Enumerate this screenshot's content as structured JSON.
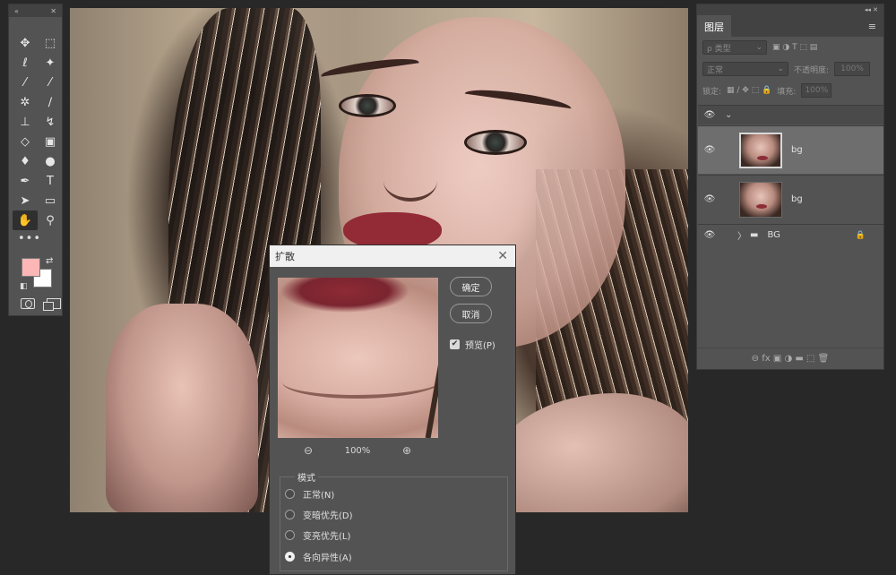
{
  "toolbar": {
    "collapse_glyph": "«",
    "close_glyph": "✕",
    "more_glyph": "•••",
    "foreground_color": "#fcb6b6",
    "background_color": "#ffffff",
    "tools": [
      {
        "name": "move-icon",
        "glyph": "✥"
      },
      {
        "name": "marquee-icon",
        "glyph": "⬚"
      },
      {
        "name": "lasso-icon",
        "glyph": "ℓ"
      },
      {
        "name": "magic-wand-icon",
        "glyph": "✦"
      },
      {
        "name": "eyedropper-icon",
        "glyph": "⁄"
      },
      {
        "name": "eyedropper-2-icon",
        "glyph": "⁄"
      },
      {
        "name": "patch-icon",
        "glyph": "✲"
      },
      {
        "name": "brush-icon",
        "glyph": "∕"
      },
      {
        "name": "stamp-icon",
        "glyph": "⊥"
      },
      {
        "name": "history-brush-icon",
        "glyph": "↯"
      },
      {
        "name": "eraser-icon",
        "glyph": "◇"
      },
      {
        "name": "gradient-icon",
        "glyph": "▣"
      },
      {
        "name": "blur-icon",
        "glyph": "♦"
      },
      {
        "name": "dodge-icon",
        "glyph": "●"
      },
      {
        "name": "pen-icon",
        "glyph": "✒"
      },
      {
        "name": "type-icon",
        "glyph": "T"
      },
      {
        "name": "path-select-icon",
        "glyph": "➤"
      },
      {
        "name": "rectangle-icon",
        "glyph": "▭"
      },
      {
        "name": "hand-icon",
        "glyph": "✋"
      },
      {
        "name": "zoom-icon",
        "glyph": "⚲"
      }
    ]
  },
  "layers_panel": {
    "top_controls": "◂◂  ✕",
    "tab_label": "图层",
    "menu_glyph": "≡",
    "filter_label": "ρ 类型",
    "filter_icons": "▣ ◑ T ⬚ ▤",
    "blend_mode": "正常",
    "opacity_label": "不透明度:",
    "opacity_value": "100%",
    "lock_label": "锁定:",
    "lock_icons": "▦ ∕ ✥ ⬚ 🔒",
    "fill_label": "填充:",
    "fill_value": "100%",
    "group_expander": "⌄",
    "layers": [
      {
        "name": "bg",
        "visible_glyph": "👁",
        "selected": true
      },
      {
        "name": "bg",
        "visible_glyph": "👁",
        "selected": false
      }
    ],
    "group": {
      "name": "BG",
      "expander": "〉",
      "folder_glyph": "▬",
      "lock_glyph": "🔒",
      "visible_glyph": "👁"
    },
    "footer_icons": "⊖  fx  ▣  ◑  ▬  ⬚  🗑"
  },
  "dialog": {
    "title": "扩散",
    "close_glyph": "✕",
    "ok_label": "确定",
    "cancel_label": "取消",
    "preview_label": "预览(P)",
    "preview_checked": true,
    "zoom_out_glyph": "⊖",
    "zoom_in_glyph": "⊕",
    "zoom_value": "100%",
    "mode_legend": "模式",
    "modes": [
      {
        "label": "正常(N)",
        "selected": false
      },
      {
        "label": "变暗优先(D)",
        "selected": false
      },
      {
        "label": "变亮优先(L)",
        "selected": false
      },
      {
        "label": "各向异性(A)",
        "selected": true
      }
    ]
  }
}
